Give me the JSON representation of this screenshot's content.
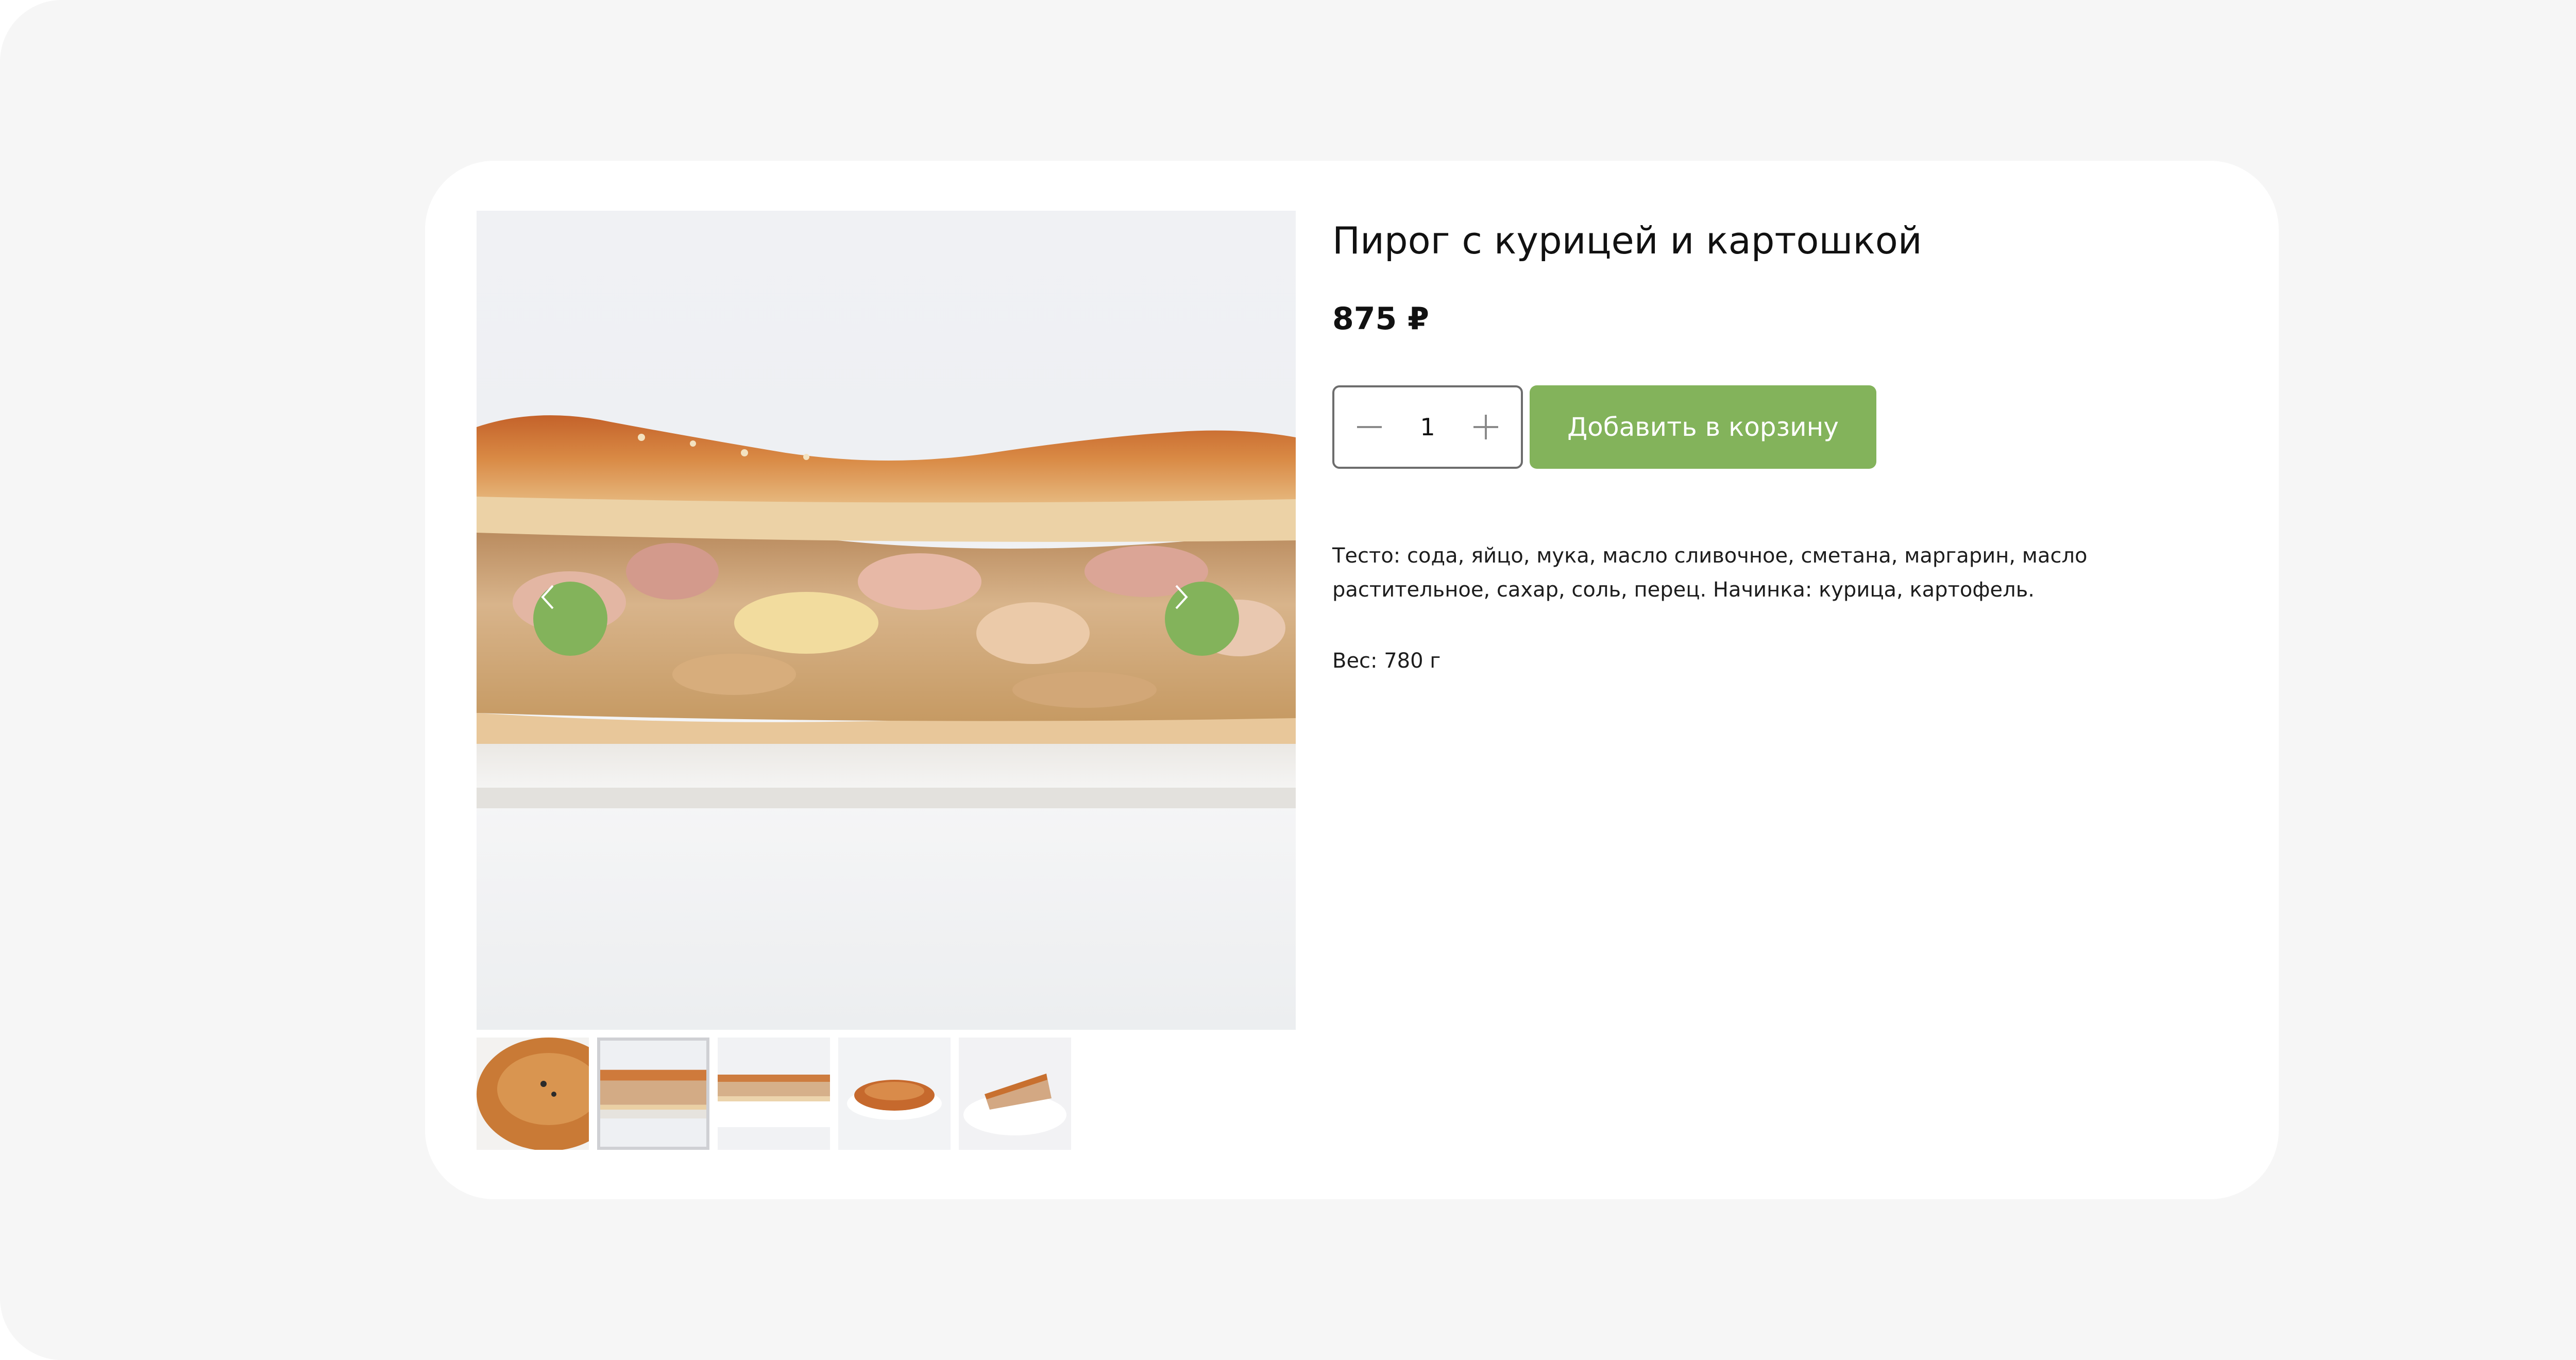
{
  "product": {
    "title": "Пирог с курицей и картошкой",
    "price": "875 ₽",
    "quantity": "1",
    "add_to_cart_label": "Добавить в корзину",
    "description": "Тесто: сода, яйцо, мука, масло сливочное, сметана, маргарин, масло растительное, сахар, соль, перец. Начинка: курица, картофель.",
    "weight": "Вес: 780 г"
  },
  "gallery": {
    "main_image": "chicken-potato-pie-cross-section-photo",
    "prev_icon": "chevron-left-icon",
    "next_icon": "chevron-right-icon",
    "active_thumbnail": 2,
    "thumbnails": [
      "pie-top-view-photo",
      "pie-cross-section-photo",
      "pie-slice-on-plate-photo",
      "whole-pie-on-plate-photo",
      "pie-piece-photo"
    ]
  },
  "colors": {
    "accent": "#83b35b",
    "background": "#f6f6f6",
    "card": "#ffffff",
    "text": "#111111"
  }
}
